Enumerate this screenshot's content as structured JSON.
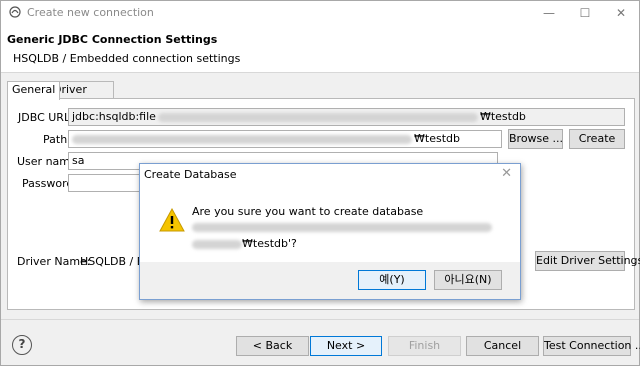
{
  "window": {
    "title": "Create new connection",
    "controls": {
      "minimize": "—",
      "maximize": "☐",
      "close": "✕"
    }
  },
  "header": {
    "title": "Generic JDBC Connection Settings",
    "subtitle": "HSQLDB / Embedded connection settings"
  },
  "tabs": [
    "General",
    "Driver properties"
  ],
  "form": {
    "jdbc_url_label": "JDBC URL:",
    "jdbc_url_prefix": "jdbc:hsqldb:file",
    "jdbc_url_suffix": "₩testdb",
    "path_label": "Path:",
    "path_suffix": "₩testdb",
    "browse_label": "Browse ...",
    "create_label": "Create",
    "username_label": "User name:",
    "username_value": "sa",
    "password_label": "Password:",
    "password_value": "",
    "driver_name_label": "Driver Name:",
    "driver_name_value": "HSQLDB / Em",
    "edit_driver_label": "Edit Driver Settings"
  },
  "footer": {
    "help_icon": "?",
    "back_label": "< Back",
    "next_label": "Next >",
    "finish_label": "Finish",
    "cancel_label": "Cancel",
    "test_label": "Test Connection ..."
  },
  "dialog": {
    "title": "Create Database",
    "close_icon": "✕",
    "icon": "warning-icon",
    "message_line1": "Are you sure you want to create database",
    "message_line2_suffix": "₩testdb'?",
    "yes_label": "예(Y)",
    "no_label": "아니요(N)"
  },
  "colors": {
    "accent": "#0078d7",
    "warning": "#f5c400"
  }
}
